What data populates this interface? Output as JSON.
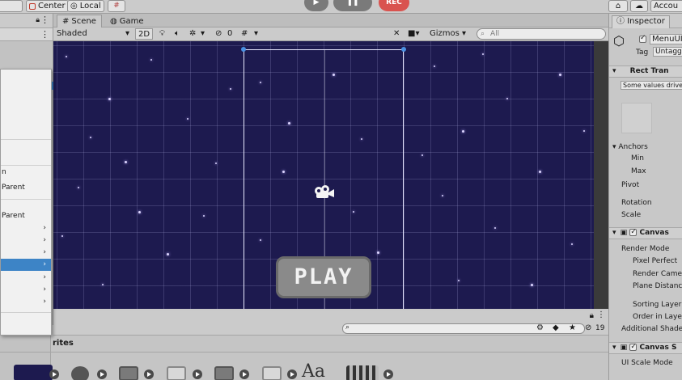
{
  "toolbar": {
    "pivot_center_label": "Center",
    "space_local_label": "Local",
    "record_label": "REC",
    "account_label": "Accou"
  },
  "scene_tabs": {
    "scene_label": "Scene",
    "game_label": "Game"
  },
  "scene_toolbar": {
    "shading_mode": "Shaded",
    "mode_2d_label": "2D",
    "hidden_count": "0",
    "gizmos_label": "Gizmos",
    "search_placeholder": "All"
  },
  "scene": {
    "play_button_text": "PLAY"
  },
  "context_menu": {
    "items": [
      {
        "label": "",
        "submenu": false
      },
      {
        "label": "",
        "submenu": false
      },
      {
        "label": "",
        "submenu": false
      },
      {
        "label": "n",
        "submenu": false
      },
      {
        "label": "Parent",
        "submenu": false
      },
      {
        "label": "",
        "submenu": false
      },
      {
        "label": "Parent",
        "submenu": false
      },
      {
        "label": "",
        "submenu": true
      },
      {
        "label": "",
        "submenu": true
      },
      {
        "label": "",
        "submenu": true
      },
      {
        "label": "",
        "submenu": true
      },
      {
        "label": "",
        "submenu": true
      },
      {
        "label": "",
        "submenu": true
      },
      {
        "label": "",
        "submenu": true
      }
    ],
    "selected_index": 9
  },
  "project": {
    "hidden_count": "19",
    "bottom_label": "rites"
  },
  "inspector": {
    "tab_label": "Inspector",
    "object_name": "MenuUI",
    "tag_label": "Tag",
    "tag_value": "Untagg",
    "rect_transform_title": "Rect Tran",
    "rect_notice": "Some values drive",
    "anchors_label": "Anchors",
    "min_label": "Min",
    "max_label": "Max",
    "pivot_label": "Pivot",
    "rotation_label": "Rotation",
    "scale_label": "Scale",
    "canvas_title": "Canvas",
    "render_mode_label": "Render Mode",
    "pixel_perfect_label": "Pixel Perfect",
    "render_camera_label": "Render Came",
    "plane_distance_label": "Plane Distanc",
    "sorting_layer_label": "Sorting Layer",
    "order_in_layer_label": "Order in Laye",
    "additional_shader_label": "Additional Shade",
    "canvas_scaler_title": "Canvas S",
    "ui_scale_mode_label": "UI Scale Mode"
  },
  "colors": {
    "scene_background": "#1d1a4f",
    "selection_blue": "#3d84c6",
    "play_button_fill": "#8a8a8a",
    "record_red": "#d9534f"
  }
}
